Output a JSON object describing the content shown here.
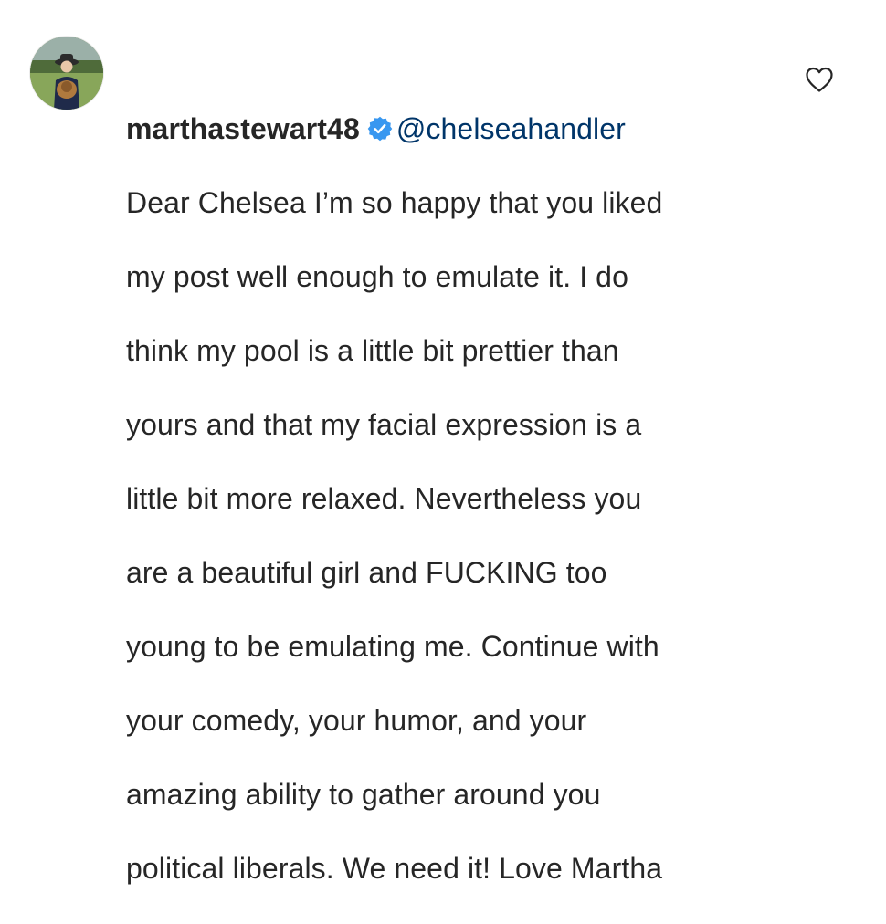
{
  "comment": {
    "username": "marthastewart48",
    "mention": "@chelseahandler",
    "lines": [
      "Dear Chelsea I’m so happy that you liked",
      "my post well enough to emulate it. I do",
      "think my pool is a little bit prettier than",
      "yours and that my facial expression is a",
      "little bit more relaxed. Nevertheless you",
      "are a beautiful girl and FUCKING too",
      "young to be emulating me. Continue with",
      "your comedy, your humor, and your",
      "amazing ability to gather around you",
      "political liberals. We need it! Love Martha"
    ]
  },
  "icons": {
    "verified": "verified-badge-icon",
    "like": "heart-outline-icon"
  },
  "colors": {
    "text": "#262626",
    "mention": "#003569",
    "verified": "#3897f0",
    "heart_stroke": "#262626"
  }
}
